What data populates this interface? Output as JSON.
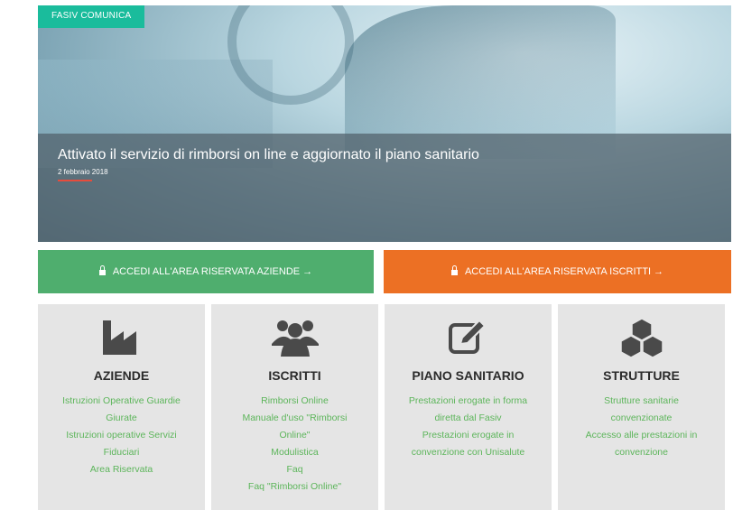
{
  "hero": {
    "tag": "FASIV COMUNICA",
    "title": "Attivato il servizio di rimborsi on line e aggiornato il piano sanitario",
    "date": "2 febbraio 2018"
  },
  "buttons": {
    "aziende": "ACCEDI ALL'AREA RISERVATA AZIENDE →",
    "iscritti": "ACCEDI ALL'AREA RISERVATA ISCRITTI →"
  },
  "cards": [
    {
      "title": "AZIENDE",
      "icon": "factory-icon",
      "links": [
        "Istruzioni Operative Guardie",
        "Giurate",
        "Istruzioni operative Servizi",
        "Fiduciari",
        "Area Riservata"
      ]
    },
    {
      "title": "ISCRITTI",
      "icon": "users-icon",
      "links": [
        "Rimborsi Online",
        "Manuale d'uso \"Rimborsi",
        "Online\"",
        "Modulistica",
        "Faq",
        "Faq \"Rimborsi Online\""
      ]
    },
    {
      "title": "PIANO SANITARIO",
      "icon": "edit-icon",
      "links": [
        "Prestazioni erogate in forma",
        "diretta dal Fasiv",
        "Prestazioni erogate in",
        "convenzione con Unisalute"
      ]
    },
    {
      "title": "STRUTTURE",
      "icon": "cubes-icon",
      "links": [
        "Strutture sanitarie",
        "convenzionate",
        "Accesso alle prestazioni in",
        "convenzione"
      ]
    }
  ],
  "colors": {
    "accent_green": "#4fae6e",
    "accent_orange": "#ec7024",
    "tag_teal": "#1abc9c",
    "link_green": "#5cb55a"
  }
}
